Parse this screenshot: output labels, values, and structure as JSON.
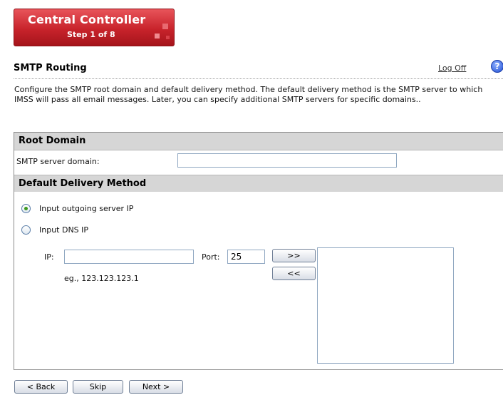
{
  "wizard": {
    "title": "Central Controller",
    "step": "Step 1 of 8"
  },
  "header": {
    "title": "SMTP Routing",
    "logoff": "Log Off",
    "help_glyph": "?"
  },
  "description": "Configure the SMTP root domain and default delivery method. The default delivery method is the SMTP server to which IMSS will pass all email messages. Later, you can specify additional SMTP servers for specific domains..",
  "root_domain": {
    "header": "Root Domain",
    "label": "SMTP server domain:",
    "value": ""
  },
  "delivery": {
    "header": "Default Delivery Method",
    "option_outgoing": "Input outgoing server IP",
    "option_dns": "Input DNS IP",
    "selected": "outgoing",
    "ip_label": "IP:",
    "ip_value": "",
    "port_label": "Port:",
    "port_value": "25",
    "example": "eg., 123.123.123.1",
    "add_label": ">>",
    "remove_label": "<<",
    "server_list": []
  },
  "footer": {
    "back": "< Back",
    "skip": "Skip",
    "next": "Next >"
  }
}
